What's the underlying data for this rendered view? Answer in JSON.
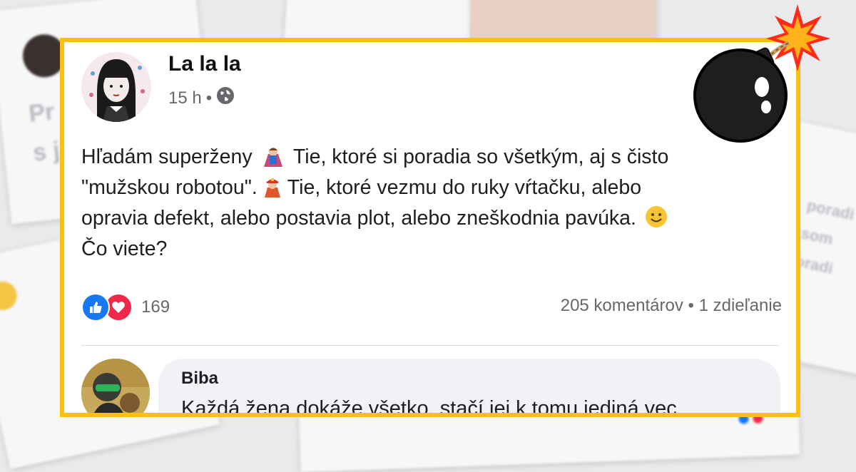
{
  "post": {
    "author": "La la la",
    "time": "15 h",
    "separator": "•",
    "globe_icon": "globe-icon",
    "text": {
      "line1_a": "Hľadám superženy",
      "line1_b": "Tie, ktoré si poradia so všetkým, aj s čisto",
      "line2_a": "\"mužskou robotou\".",
      "line2_b": "Tie, ktoré vezmu do ruky vŕtačku, alebo",
      "line3": "opravia defekt, alebo postavia plot, alebo zneškodnia pavúka.",
      "line4": "Čo viete?"
    },
    "emojis": [
      "superhero-woman-icon",
      "firefighter-woman-icon",
      "smile-icon"
    ],
    "reaction_icons": [
      "like-icon",
      "love-icon"
    ],
    "reaction_count": "169",
    "comments_label": "205 komentárov",
    "stats_separator": "•",
    "shares_label": "1 zdieľanie"
  },
  "comment": {
    "author": "Biba",
    "text": "Každá žena dokáže všetko, stačí jej k tomu jediná vec"
  },
  "decoration": {
    "bomb_icon": "bomb-icon",
    "frame_color": "#fbbf12",
    "like_color": "#1877f2",
    "love_color": "#f0284a"
  }
}
